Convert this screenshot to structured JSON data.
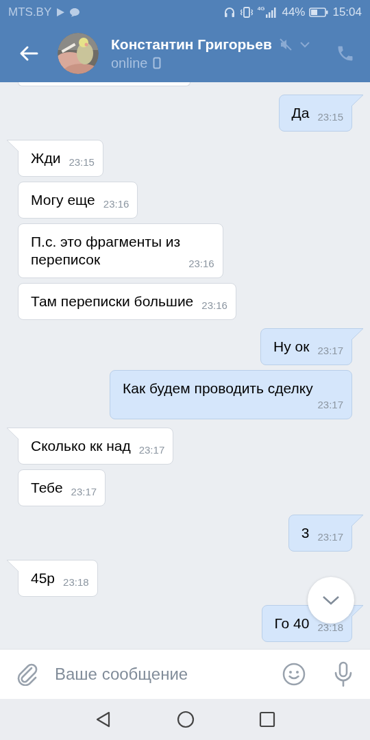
{
  "status_bar": {
    "carrier": "MTS.BY",
    "network": "4G",
    "battery": "44%",
    "time": "15:04"
  },
  "header": {
    "name": "Константин Григорьев",
    "status": "online",
    "muted": true
  },
  "messages": [
    {
      "kind": "outgoing",
      "tail": true,
      "text": "Да",
      "time": "23:15"
    },
    {
      "kind": "incoming",
      "tail": true,
      "text": "Жди",
      "time": "23:15"
    },
    {
      "kind": "incoming",
      "tail": false,
      "text": "Могу еще",
      "time": "23:16"
    },
    {
      "kind": "incoming",
      "tail": false,
      "text": "П.с. это фрагменты из\nпереписок",
      "time": "23:16"
    },
    {
      "kind": "incoming",
      "tail": false,
      "text": "Там переписки большие",
      "time": "23:16"
    },
    {
      "kind": "outgoing",
      "tail": true,
      "text": "Ну ок",
      "time": "23:17"
    },
    {
      "kind": "outgoing",
      "tail": false,
      "text": "Как будем проводить сделку",
      "time": "23:17"
    },
    {
      "kind": "incoming",
      "tail": true,
      "text": "Сколько кк над",
      "time": "23:17"
    },
    {
      "kind": "incoming",
      "tail": false,
      "text": "Тебе",
      "time": "23:17"
    },
    {
      "kind": "outgoing",
      "tail": true,
      "text": "3",
      "time": "23:17"
    },
    {
      "kind": "incoming",
      "tail": true,
      "text": "45р",
      "time": "23:18"
    },
    {
      "kind": "outgoing",
      "tail": true,
      "text": "Го 40",
      "time": "23:18"
    }
  ],
  "composer": {
    "placeholder": "Ваше сообщение"
  }
}
